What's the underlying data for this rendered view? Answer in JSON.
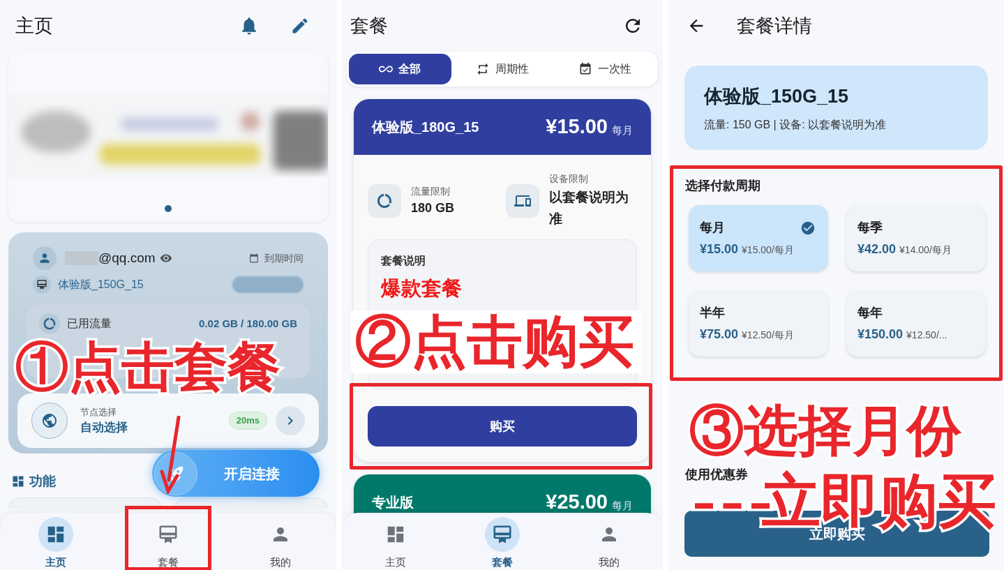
{
  "home": {
    "title": "主页",
    "account": {
      "email": "@qq.com",
      "expire_label": "到期时间",
      "plan": "体验版_150G_15"
    },
    "traffic": {
      "label": "已用流量",
      "value": "0.02 GB / 180.00 GB"
    },
    "node": {
      "label": "节点选择",
      "value": "自动选择",
      "latency": "20ms"
    },
    "connect": "开启连接",
    "section": "功能",
    "nav": [
      {
        "label": "主页",
        "selected": true
      },
      {
        "label": "套餐",
        "selected": false
      },
      {
        "label": "我的",
        "selected": false
      }
    ],
    "annotation": "①点击套餐"
  },
  "plans": {
    "title": "套餐",
    "filters": [
      {
        "label": "全部",
        "selected": true
      },
      {
        "label": "周期性",
        "selected": false
      },
      {
        "label": "一次性",
        "selected": false
      }
    ],
    "cards": [
      {
        "name": "体验版_180G_15",
        "price": "¥15.00",
        "period": "每月",
        "color": "#303f9f",
        "traffic_label": "流量限制",
        "traffic": "180 GB",
        "device_label": "设备限制",
        "device": "以套餐说明为准",
        "desc_title": "套餐说明",
        "desc_highlight": "爆款套餐",
        "buy": "购买"
      },
      {
        "name": "专业版",
        "price": "¥25.00",
        "period": "每月",
        "color": "#00796b"
      }
    ],
    "nav": [
      {
        "label": "主页",
        "selected": false
      },
      {
        "label": "套餐",
        "selected": true
      },
      {
        "label": "我的",
        "selected": false
      }
    ],
    "annotation": "②点击购买"
  },
  "detail": {
    "title": "套餐详情",
    "plan": {
      "name": "体验版_150G_15",
      "info": "流量: 150 GB | 设备: 以套餐说明为准"
    },
    "cycle_title": "选择付款周期",
    "cycles": [
      {
        "label": "每月",
        "price": "¥15.00",
        "per": "¥15.00/每月",
        "selected": true
      },
      {
        "label": "每季",
        "price": "¥42.00",
        "per": "¥14.00/每月",
        "selected": false
      },
      {
        "label": "半年",
        "price": "¥75.00",
        "per": "¥12.50/每月",
        "selected": false
      },
      {
        "label": "每年",
        "price": "¥150.00",
        "per": "¥12.50/...",
        "selected": false
      }
    ],
    "coupon_label": "使用优惠券",
    "buy": "立即购买",
    "annotations": [
      "③选择月份",
      "---",
      "立即购买"
    ]
  }
}
